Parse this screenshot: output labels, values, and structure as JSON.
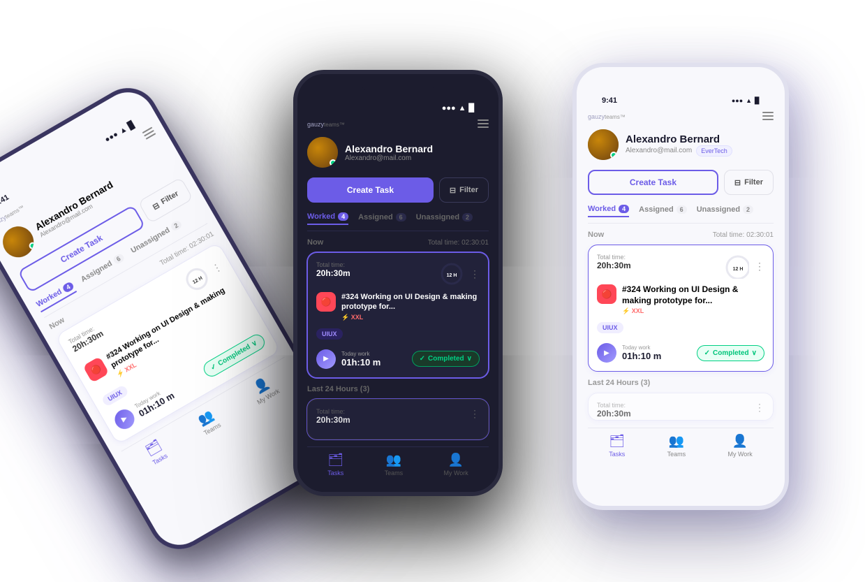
{
  "brand": {
    "name": "gauzy",
    "suffix": "teams™"
  },
  "user": {
    "name": "Alexandro Bernard",
    "email": "Alexandro@mail.com",
    "company": "EverTech"
  },
  "buttons": {
    "create_task": "Create Task",
    "filter": "Filter"
  },
  "tabs": [
    {
      "label": "Worked",
      "count": "4",
      "active": true
    },
    {
      "label": "Assigned",
      "count": "6",
      "active": false
    },
    {
      "label": "Unassigned",
      "count": "2",
      "active": false
    }
  ],
  "sections": {
    "now": {
      "label": "Now",
      "total_time_label": "Total time:",
      "total_time": "02:30:01"
    },
    "last24": {
      "label": "Last 24 Hours (3)",
      "total_time_label": "Total time:",
      "total_time": "20h:30m"
    }
  },
  "task_card_now": {
    "time_label": "Total time:",
    "time_value": "20h:30m",
    "task_id": "#324",
    "task_title": "Working on UI Design & making prototype for...",
    "size": "XXL",
    "tag": "UIUX",
    "hours": "12 H",
    "today_work_label": "Today work",
    "today_work_value": "01h:10 m",
    "status": "Completed",
    "menu": "⋮"
  },
  "task_card_last": {
    "time_label": "Total time:",
    "time_value": "20h:30m",
    "menu": "⋮"
  },
  "nav": {
    "tasks": "Tasks",
    "teams": "Teams",
    "my_work": "My Work"
  },
  "status_bar": {
    "time": "9:41",
    "signal": "●●●",
    "wifi": "▲",
    "battery": "▉"
  }
}
